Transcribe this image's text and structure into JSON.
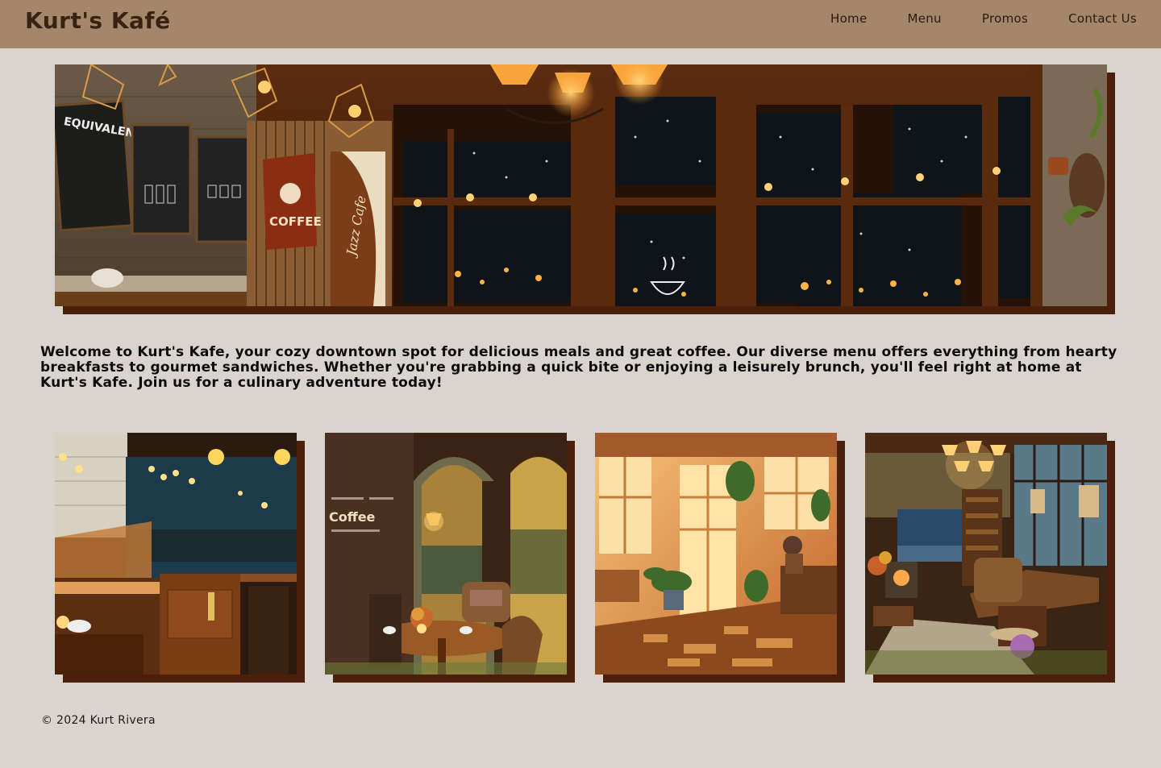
{
  "nav": {
    "brand": "Kurt's Kafé",
    "links": [
      "Home",
      "Menu",
      "Promos",
      "Contact Us"
    ]
  },
  "hero": {
    "alt": "Cozy café interior at night",
    "signs": {
      "equivalent": "EQUIVALENT",
      "coffee": "COFFEE",
      "jazz": "Jazz Cafe"
    }
  },
  "intro": {
    "text": "Welcome to Kurt's Kafe, your cozy downtown spot for delicious meals and great coffee. Our diverse menu offers everything from hearty breakfasts to gourmet sandwiches. Whether you're grabbing a quick bite or enjoying a leisurely brunch, you'll feel right at home at Kurt's Kafe. Join us for a culinary adventure today!"
  },
  "gallery": [
    {
      "alt": "Rainy night bakery café"
    },
    {
      "alt": "Autumn café with arched windows",
      "sign": "Coffee"
    },
    {
      "alt": "Sunlit café with plants"
    },
    {
      "alt": "Lakeside café lounge"
    }
  ],
  "footer": {
    "text": "© 2024 Kurt Rivera"
  },
  "colors": {
    "background": "#d9d5ce",
    "nav": "#a4876b",
    "brand": "#3a2213",
    "shadow": "#4a200b"
  }
}
